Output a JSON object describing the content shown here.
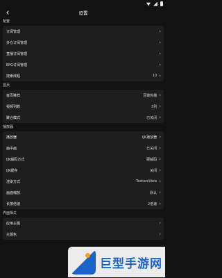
{
  "header": {
    "title": "设置"
  },
  "sections": [
    {
      "title": "配置",
      "rows": [
        {
          "label": "订阅管理",
          "value": ""
        },
        {
          "label": "多仓订阅管理",
          "value": ""
        },
        {
          "label": "直播订阅管理",
          "value": ""
        },
        {
          "label": "EPG订阅管理",
          "value": ""
        },
        {
          "label": "搜索线程",
          "value": "10"
        }
      ]
    },
    {
      "title": "首页",
      "rows": [
        {
          "label": "首页推荐",
          "value": "豆瓣热播"
        },
        {
          "label": "视频列数",
          "value": "3列"
        },
        {
          "label": "聚合模式",
          "value": "已关闭"
        }
      ]
    },
    {
      "title": "播放器",
      "rows": [
        {
          "label": "播放器",
          "value": "IJK播放器"
        },
        {
          "label": "画中画",
          "value": "已关闭"
        },
        {
          "label": "IJK解码方式",
          "value": "硬解码"
        },
        {
          "label": "IJK缓存",
          "value": "关闭"
        },
        {
          "label": "渲染方式",
          "value": "TextureView"
        },
        {
          "label": "画面缩放",
          "value": "默认"
        },
        {
          "label": "长按倍速",
          "value": "2倍速"
        }
      ]
    },
    {
      "title": "界面相关",
      "rows": [
        {
          "label": "应用主题",
          "value": ""
        },
        {
          "label": "主题色",
          "value": ""
        }
      ]
    }
  ],
  "watermark": {
    "text": "巨型手游网"
  }
}
